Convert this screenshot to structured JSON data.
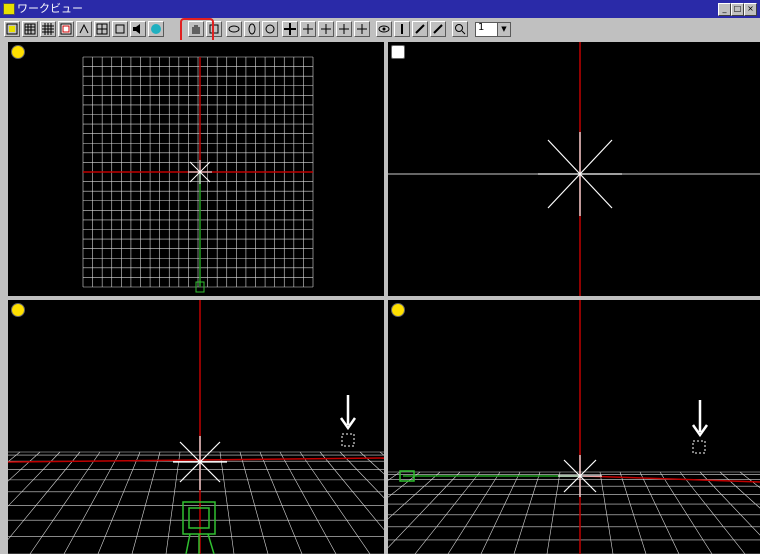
{
  "window": {
    "title": "ワークビュー"
  },
  "toolbar": {
    "buttons": [
      "work-view",
      "grid-a",
      "grid-b",
      "grid-c",
      "snap",
      "grid-d",
      "grid-e",
      "speaker",
      "sphere",
      "hand",
      "frame",
      "rotate-a",
      "rotate-b",
      "rotate-c",
      "move",
      "move-a",
      "move-b",
      "move-c",
      "move-d",
      "eye",
      "pin",
      "brush-a",
      "brush-b",
      "zoom-tool"
    ],
    "zoom_value": "1"
  },
  "viewports": [
    {
      "name": "top-view",
      "icon": "yellow-camera-icon"
    },
    {
      "name": "camera-view",
      "icon": "camera-icon"
    },
    {
      "name": "front-view",
      "icon": "yellow-camera-icon"
    },
    {
      "name": "perspective-view",
      "icon": "yellow-camera-icon"
    }
  ],
  "colors": {
    "axis_red": "#c00000",
    "axis_green": "#20a020",
    "grid": "#ffffff",
    "titlebar": "#2a2aa8"
  }
}
